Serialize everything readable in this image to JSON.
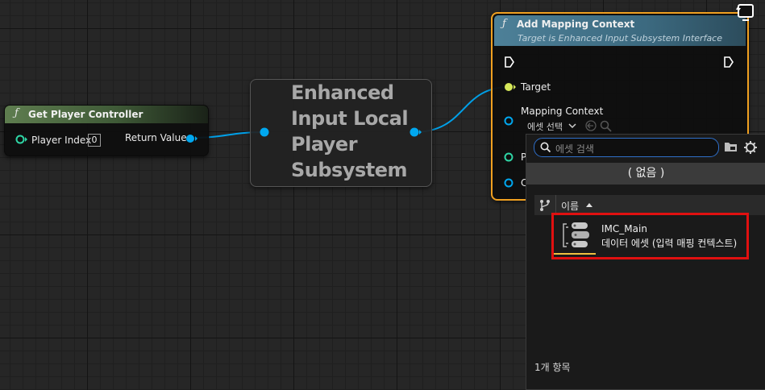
{
  "get_player_controller": {
    "function_glyph": "ƒ",
    "title": "Get Player Controller",
    "player_index_label": "Player Index",
    "player_index_value": "0",
    "return_value_label": "Return Value"
  },
  "subsystem_node": {
    "title": "Enhanced Input Local Player Subsystem"
  },
  "add_mapping_context": {
    "function_glyph": "ƒ",
    "title": "Add Mapping Context",
    "subtitle": "Target is Enhanced Input Subsystem Interface",
    "target_label": "Target",
    "mapping_context_label": "Mapping Context",
    "asset_select_label": "에셋 선택",
    "pin_p_label": "P",
    "pin_c_label": "C"
  },
  "asset_picker": {
    "search_placeholder": "에셋 검색",
    "none_option": "( 없음 )",
    "sort_column_label": "이름",
    "items": [
      {
        "name": "IMC_Main",
        "type": "데이터 에셋 (입력 매핑 컨텍스트)"
      }
    ],
    "item_count": "1개 항목"
  },
  "colors": {
    "exec_pin": "#ffffff",
    "object_pin": "#00a8f0",
    "struct_pin": "#2fd6a6",
    "target_pin": "#d6e85a",
    "selection_outline": "#f0a020",
    "highlight_box": "#e01010"
  }
}
